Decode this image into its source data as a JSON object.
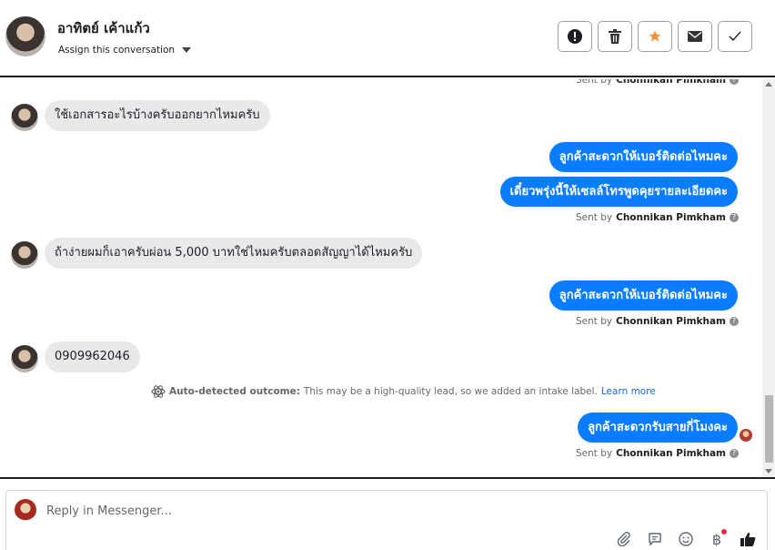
{
  "header": {
    "contact_name": "อาทิตย์ เค้าแก้ว",
    "assign_label": "Assign this conversation",
    "actions": [
      {
        "name": "spam-button",
        "icon": "exclamation-icon",
        "glyph": "❗"
      },
      {
        "name": "delete-button",
        "icon": "trash-icon",
        "glyph": "🗑"
      },
      {
        "name": "star-button",
        "icon": "star-icon",
        "glyph": "★"
      },
      {
        "name": "mark-unread-button",
        "icon": "envelope-icon",
        "glyph": "✉"
      },
      {
        "name": "done-button",
        "icon": "check-icon",
        "glyph": "✓"
      }
    ]
  },
  "thread": {
    "sent_by_prefix": "Sent by",
    "agent_name": "Chonnikan Pimkham",
    "messages": [
      {
        "dir": "in",
        "text": "ใช้เอกสารอะไรบ้างครับออกยากไหมครับ"
      },
      {
        "dir": "out",
        "text": "ลูกค้าสะดวกให้เบอร์ติดต่อไหมคะ"
      },
      {
        "dir": "out",
        "text": "เดี๋ยวพรุ่งนี้ให้เซลล์โทรพูดคุยรายละเอียดคะ"
      },
      {
        "dir": "in",
        "text": "ถ้าง่ายผมก็เอาครับผ่อน 5,000 บาทใช่ไหมครับตลอดสัญญาได้ไหมครับ"
      },
      {
        "dir": "out",
        "text": "ลูกค้าสะดวกให้เบอร์ติดต่อไหมคะ"
      },
      {
        "dir": "in",
        "text": "0909962046"
      },
      {
        "dir": "out",
        "text": "ลูกค้าสะดวกรับสายกี่โมงคะ"
      }
    ],
    "outcome": {
      "title": "Auto-detected outcome:",
      "text": "This may be a high-quality lead, so we added an intake label.",
      "link": "Learn more"
    }
  },
  "composer": {
    "placeholder": "Reply in Messenger...",
    "tools": [
      "paperclip-icon",
      "saved-reply-icon",
      "emoji-icon",
      "baht-payment-icon",
      "thumbs-up-icon"
    ]
  },
  "colors": {
    "accent": "#0a7cff",
    "incoming_bubble": "#e9e9eb",
    "star": "#f7923a",
    "link": "#1a66d2"
  }
}
